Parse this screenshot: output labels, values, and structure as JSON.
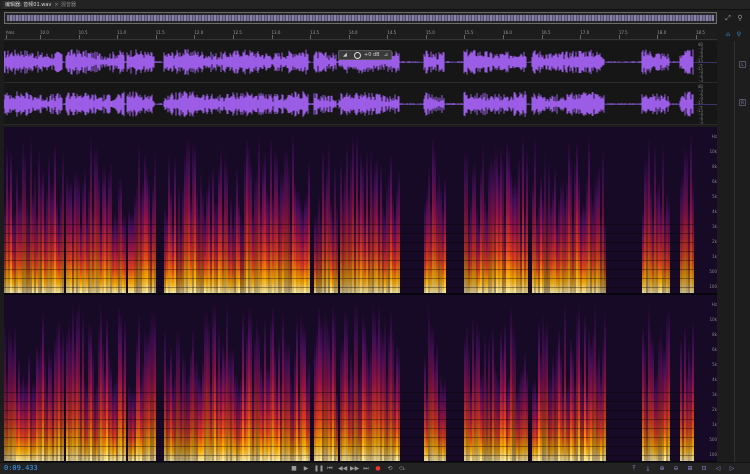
{
  "tabs": [
    {
      "label": "编辑器: 音频01.wav",
      "active": true,
      "close": "×"
    },
    {
      "label": "混音器",
      "active": false
    }
  ],
  "overview": {
    "icons": [
      "zoom-to-selection-icon",
      "pin-icon"
    ]
  },
  "ruler": {
    "ticks": [
      "hms",
      "10.0",
      "10.5",
      "11.0",
      "11.5",
      "12.0",
      "12.5",
      "13.0",
      "13.5",
      "14.0",
      "14.5",
      "15.0",
      "15.5",
      "16.0",
      "16.5",
      "17.0",
      "17.5",
      "18.0",
      "18.5"
    ],
    "icons": [
      "home-icon",
      "pin-icon"
    ]
  },
  "waveform": {
    "db_labels_top": [
      "dB",
      "-3",
      "-6",
      "-9",
      "-15",
      "-∞",
      "-15",
      "-9",
      "-6",
      "-3"
    ],
    "db_labels_bottom": [
      "dB",
      "-3",
      "-6",
      "-9",
      "-15",
      "-∞",
      "-15",
      "-9",
      "-6",
      "-3"
    ],
    "hud": {
      "volume_label": "◢",
      "value": "+0 dB",
      "pin": "⊿"
    },
    "color": "#9b5de5"
  },
  "spectral": {
    "hz_labels_top": [
      "Hz",
      "10k",
      "8k",
      "6k",
      "5k",
      "4k",
      "3k",
      "2k",
      "1k",
      "500",
      "100"
    ],
    "hz_labels_bottom": [
      "Hz",
      "10k",
      "8k",
      "6k",
      "5k",
      "4k",
      "3k",
      "2k",
      "1k",
      "500",
      "100"
    ]
  },
  "right_strip": {
    "buttons": [
      "L",
      "R"
    ]
  },
  "bottombar": {
    "timecode": "0:09.433",
    "transport": [
      "stop-icon",
      "play-icon",
      "pause-icon",
      "go-to-start-icon",
      "rewind-icon",
      "fast-forward-icon",
      "go-to-end-icon",
      "record-icon",
      "loop-icon",
      "skip-selection-icon"
    ],
    "transport_glyphs": [
      "■",
      "▶",
      "❚❚",
      "⏮",
      "◀◀",
      "▶▶",
      "⏭",
      "●",
      "⟲",
      "⤼"
    ],
    "zoom": [
      "zoom-in-amplitude-icon",
      "zoom-out-amplitude-icon",
      "zoom-in-time-icon",
      "zoom-out-time-icon",
      "zoom-out-full-icon",
      "zoom-to-selection-icon",
      "zoom-in-left-icon",
      "zoom-in-right-icon"
    ],
    "zoom_glyphs": [
      "⤒",
      "⤓",
      "⊕",
      "⊖",
      "⊞",
      "⊡",
      "◁",
      "▷"
    ]
  }
}
